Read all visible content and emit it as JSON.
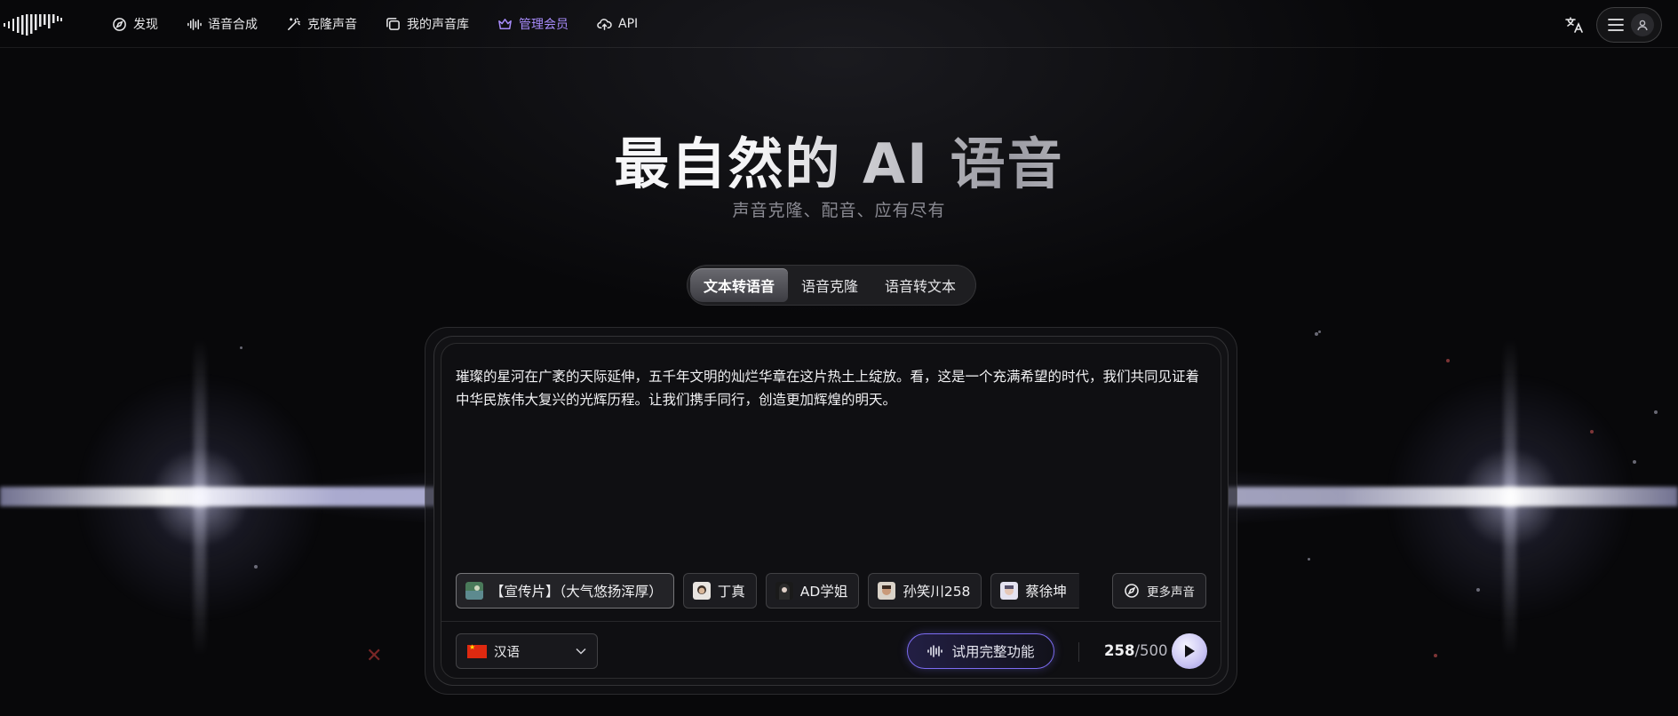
{
  "nav": {
    "items": [
      {
        "label": "发现",
        "icon": "compass-icon"
      },
      {
        "label": "语音合成",
        "icon": "waveform-icon"
      },
      {
        "label": "克隆声音",
        "icon": "magic-wand-icon"
      },
      {
        "label": "我的声音库",
        "icon": "library-icon"
      },
      {
        "label": "管理会员",
        "icon": "crown-icon",
        "active": true
      },
      {
        "label": "API",
        "icon": "cloud-icon"
      }
    ]
  },
  "hero": {
    "title": "最自然的 AI 语音",
    "subtitle": "声音克隆、配音、应有尽有"
  },
  "tabs": [
    {
      "label": "文本转语音",
      "active": true
    },
    {
      "label": "语音克隆"
    },
    {
      "label": "语音转文本"
    }
  ],
  "editor": {
    "text": "璀璨的星河在广袤的天际延伸，五千年文明的灿烂华章在这片热土上绽放。看，这是一个充满希望的时代，我们共同见证着中华民族伟大复兴的光辉历程。让我们携手同行，创造更加辉煌的明天。"
  },
  "voices": [
    {
      "label": "【宣传片】（大气悠扬浑厚）",
      "selected": true
    },
    {
      "label": "丁真"
    },
    {
      "label": "AD学姐"
    },
    {
      "label": "孙笑川258"
    },
    {
      "label": "蔡徐坤"
    }
  ],
  "more_voices_label": "更多声音",
  "language": {
    "selected": "汉语"
  },
  "try_full_label": "试用完整功能",
  "counter": {
    "current": "258",
    "max": "/500"
  },
  "colors": {
    "accent": "#a78bfa",
    "try_border": "#7c6cf2"
  }
}
